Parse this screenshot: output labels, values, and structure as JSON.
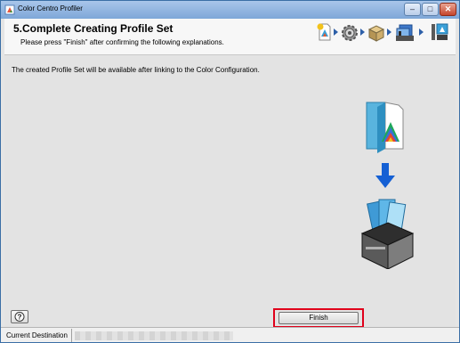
{
  "window": {
    "title": "Color Centro Profiler",
    "minimize_glyph": "–",
    "maximize_glyph": "□",
    "close_glyph": "✕",
    "close_color": "#c5452c"
  },
  "header": {
    "title": "5.Complete Creating Profile Set",
    "subtitle": "Please press \"Finish\" after confirming the following explanations.",
    "step_icons": [
      "profile-document-icon",
      "gear-icon",
      "package-icon",
      "color-configuration-icon",
      "finish-flag-icon"
    ]
  },
  "content": {
    "info_text": "The created Profile Set will be available after linking to the Color Configuration.",
    "illustration_icons": [
      "profile-set-document-icon",
      "down-arrow-icon",
      "color-configuration-box-icon"
    ]
  },
  "footer": {
    "help_icon": "help-icon",
    "help_glyph": "?",
    "finish_label": "Finish",
    "highlight_color": "#e0001b"
  },
  "statusbar": {
    "label": "Current Destination"
  }
}
